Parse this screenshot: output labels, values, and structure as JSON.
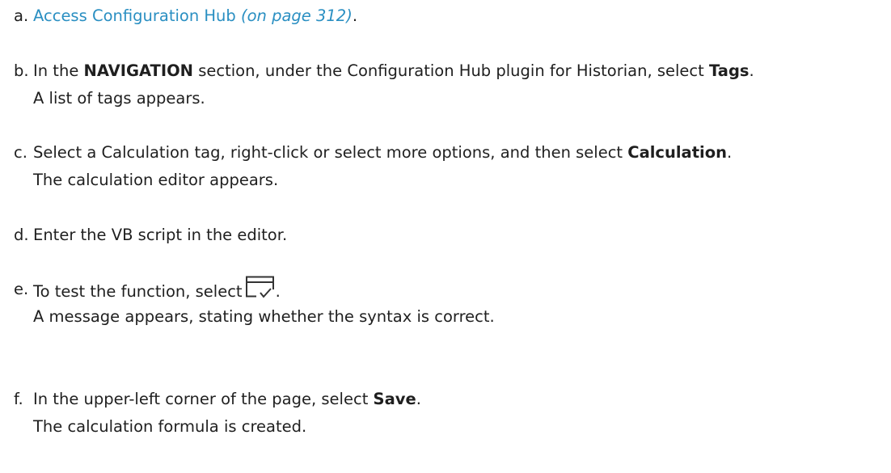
{
  "steps": [
    {
      "marker": "a.",
      "link_text": "Access Configuration Hub",
      "link_page": "(on page 312)",
      "trailing": "."
    },
    {
      "marker": "b.",
      "pre": "In the ",
      "bold1": "NAVIGATION",
      "mid": " section, under the Configuration Hub plugin for Historian, select ",
      "bold2": "Tags",
      "post": ".",
      "result": "A list of tags appears."
    },
    {
      "marker": "c.",
      "pre": "Select a Calculation tag, right-click or select more options, and then select ",
      "bold": "Calculation",
      "post": ".",
      "result": "The calculation editor appears."
    },
    {
      "marker": "d.",
      "text": "Enter the VB script in the editor."
    },
    {
      "marker": "e.",
      "pre": "To test the function, select",
      "icon": "test-function-icon",
      "post": ".",
      "result": "A message appears, stating whether the syntax is correct."
    },
    {
      "marker": "f.",
      "pre": "In the upper-left corner of the page, select ",
      "bold": "Save",
      "post": ".",
      "result": "The calculation formula is created."
    }
  ],
  "colors": {
    "text": "#1f1f1f",
    "link": "#2a8fc2"
  }
}
